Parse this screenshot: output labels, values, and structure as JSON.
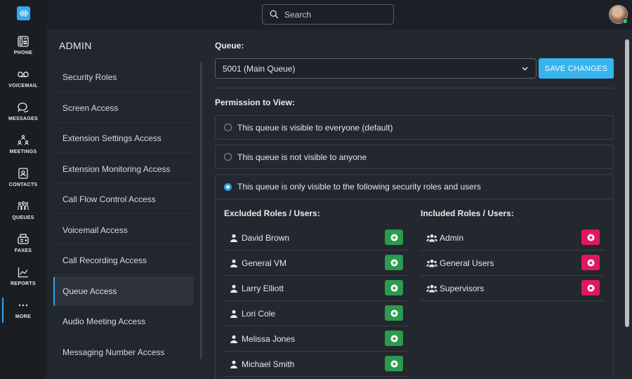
{
  "nav": {
    "items": [
      {
        "label": "PHONE",
        "icon": "phone-icon"
      },
      {
        "label": "VOICEMAIL",
        "icon": "voicemail-icon"
      },
      {
        "label": "MESSAGES",
        "icon": "messages-icon"
      },
      {
        "label": "MEETINGS",
        "icon": "meetings-icon"
      },
      {
        "label": "CONTACTS",
        "icon": "contacts-icon"
      },
      {
        "label": "QUEUES",
        "icon": "queues-icon"
      },
      {
        "label": "FAXES",
        "icon": "fax-icon"
      },
      {
        "label": "REPORTS",
        "icon": "reports-icon"
      },
      {
        "label": "MORE",
        "icon": "more-icon"
      }
    ],
    "active": "MORE"
  },
  "search": {
    "placeholder": "Search"
  },
  "admin": {
    "title": "ADMIN",
    "items": [
      {
        "label": "Security Roles"
      },
      {
        "label": "Screen Access"
      },
      {
        "label": "Extension Settings Access"
      },
      {
        "label": "Extension Monitoring Access"
      },
      {
        "label": "Call Flow Control Access"
      },
      {
        "label": "Voicemail Access"
      },
      {
        "label": "Call Recording Access"
      },
      {
        "label": "Queue Access"
      },
      {
        "label": "Audio Meeting Access"
      },
      {
        "label": "Messaging Number Access"
      }
    ],
    "active": "Queue Access"
  },
  "queue": {
    "label": "Queue:",
    "selected": "5001 (Main Queue)",
    "save_label": "SAVE CHANGES"
  },
  "permission": {
    "label": "Permission to View:",
    "options": [
      {
        "label": "This queue is visible to everyone (default)",
        "selected": false
      },
      {
        "label": "This queue is not visible to anyone",
        "selected": false
      },
      {
        "label": "This queue is only visible to the following security roles and users",
        "selected": true
      }
    ]
  },
  "roles": {
    "excluded_title": "Excluded Roles / Users:",
    "included_title": "Included Roles / Users:",
    "excluded": [
      {
        "name": "David Brown",
        "type": "user"
      },
      {
        "name": "General VM",
        "type": "user"
      },
      {
        "name": "Larry Elliott",
        "type": "user"
      },
      {
        "name": "Lori Cole",
        "type": "user"
      },
      {
        "name": "Melissa Jones",
        "type": "user"
      },
      {
        "name": "Michael Smith",
        "type": "user"
      }
    ],
    "included": [
      {
        "name": "Admin",
        "type": "group"
      },
      {
        "name": "General Users",
        "type": "group"
      },
      {
        "name": "Supervisors",
        "type": "group"
      }
    ]
  },
  "colors": {
    "accent": "#36b4ef",
    "add": "#2c9a4f",
    "remove": "#e0195e",
    "online": "#3fbf6b"
  }
}
